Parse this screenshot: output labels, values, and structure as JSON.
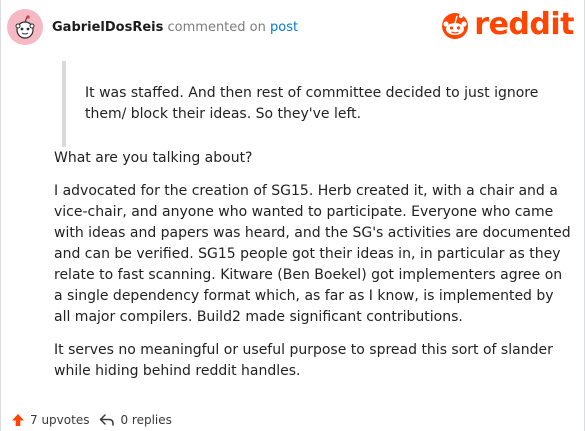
{
  "comment": {
    "author": "GabrielDosReis",
    "action": "commented on",
    "target": "post",
    "quote": "It was staffed. And then rest of committee decided to just ignore them/ block their ideas. So they've left.",
    "paragraphs": [
      "What are you talking about?",
      "I advocated for the creation of SG15. Herb created it, with a chair and a vice-chair, and anyone who wanted to participate. Everyone who came with ideas and papers was heard, and the SG's activities are documented and can be verified. SG15 people got their ideas in, in particular as they relate to fast scanning. Kitware (Ben Boekel) got implementers agree on a single dependency format which, as far as I know, is implemented by all major compilers. Build2 made significant contributions.",
      "It serves no meaningful or useful purpose to spread this sort of slander while hiding behind reddit handles."
    ]
  },
  "footer": {
    "upvotes": "7 upvotes",
    "replies": "0 replies"
  },
  "brand": {
    "wordmark": "reddit",
    "color": "#ff4500"
  },
  "icons": {
    "avatar": "snoo-avatar-icon",
    "logo": "reddit-logo-icon",
    "upvote": "upvote-arrow-icon",
    "reply": "reply-arrow-icon"
  }
}
